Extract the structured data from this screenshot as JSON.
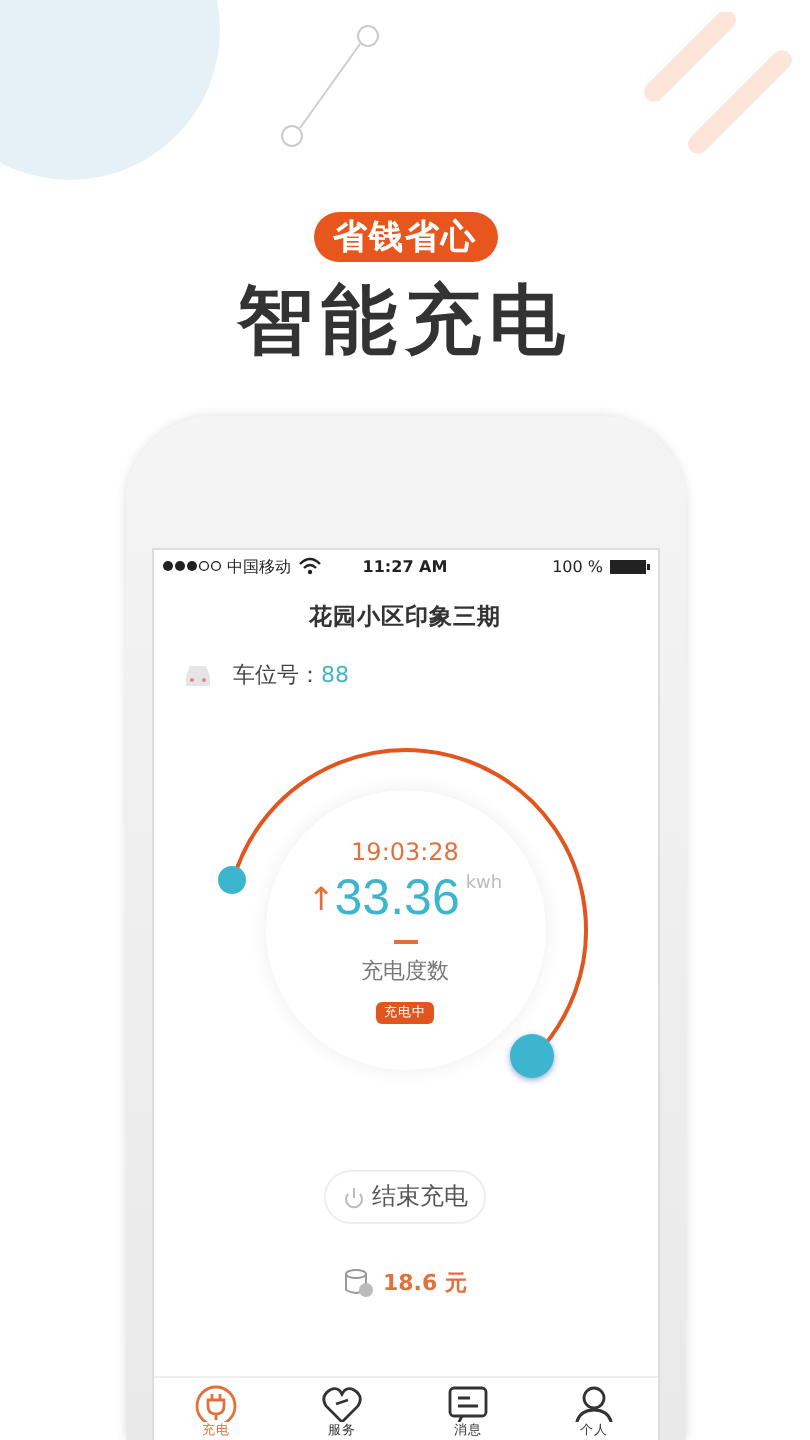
{
  "promo": {
    "badge": "省钱省心",
    "headline": "智能充电"
  },
  "status_bar": {
    "carrier": "中国移动",
    "time": "11:27 AM",
    "battery": "100 %"
  },
  "screen": {
    "title": "花园小区印象三期",
    "spot_label": "车位号：",
    "spot_value": "88"
  },
  "charging": {
    "time": "19:03:28",
    "arrow": "↑",
    "value": "33.36",
    "unit": "kwh",
    "caption": "充电度数",
    "status": "充电中",
    "level": 0.58
  },
  "stop_button": "结束充电",
  "cost": "18.6 元",
  "tabs": [
    {
      "label": "充电",
      "selected": true
    },
    {
      "label": "服务",
      "selected": false
    },
    {
      "label": "消息",
      "selected": false
    },
    {
      "label": "个人",
      "selected": false
    }
  ]
}
